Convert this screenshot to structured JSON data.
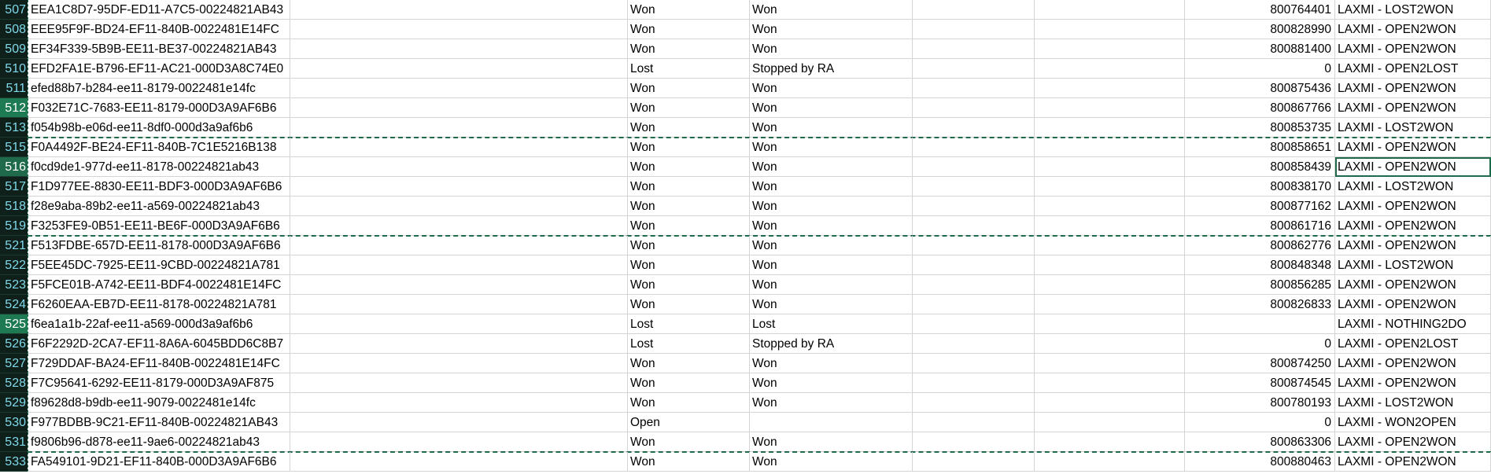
{
  "colors": {
    "accent": "#1e6a4a",
    "rownum_bg": "#0f1f1a",
    "rownum_text": "#7fd9ea",
    "grid": "#d4d4d4"
  },
  "rows": [
    {
      "n": "507",
      "id": "EEA1C8D7-95DF-ED11-A7C5-00224821AB43",
      "status": "Won",
      "outcome": "Won",
      "num": "800764401",
      "label": "LAXMI - LOST2WON"
    },
    {
      "n": "508",
      "id": "EEE95F9F-BD24-EF11-840B-0022481E14FC",
      "status": "Won",
      "outcome": "Won",
      "num": "800828990",
      "label": "LAXMI - OPEN2WON"
    },
    {
      "n": "509",
      "id": "EF34F339-5B9B-EE11-BE37-00224821AB43",
      "status": "Won",
      "outcome": "Won",
      "num": "800881400",
      "label": "LAXMI - OPEN2WON"
    },
    {
      "n": "510",
      "id": "EFD2FA1E-B796-EF11-AC21-000D3A8C74E0",
      "status": "Lost",
      "outcome": "Stopped by RA",
      "num": "0",
      "label": "LAXMI - OPEN2LOST"
    },
    {
      "n": "511",
      "id": "efed88b7-b284-ee11-8179-0022481e14fc",
      "status": "Won",
      "outcome": "Won",
      "num": "800875436",
      "label": "LAXMI - OPEN2WON"
    },
    {
      "n": "512",
      "id": "F032E71C-7683-EE11-8179-000D3A9AF6B6",
      "status": "Won",
      "outcome": "Won",
      "num": "800867766",
      "label": "LAXMI - OPEN2WON"
    },
    {
      "n": "513",
      "id": "f054b98b-e06d-ee11-8df0-000d3a9af6b6",
      "status": "Won",
      "outcome": "Won",
      "num": "800853735",
      "label": "LAXMI - LOST2WON"
    },
    {
      "n": "515",
      "id": "F0A4492F-BE24-EF11-840B-7C1E5216B138",
      "status": "Won",
      "outcome": "Won",
      "num": "800858651",
      "label": "LAXMI - OPEN2WON"
    },
    {
      "n": "516",
      "id": "f0cd9de1-977d-ee11-8178-00224821ab43",
      "status": "Won",
      "outcome": "Won",
      "num": "800858439",
      "label": "LAXMI - OPEN2WON"
    },
    {
      "n": "517",
      "id": "F1D977EE-8830-EE11-BDF3-000D3A9AF6B6",
      "status": "Won",
      "outcome": "Won",
      "num": "800838170",
      "label": "LAXMI - LOST2WON"
    },
    {
      "n": "518",
      "id": "f28e9aba-89b2-ee11-a569-00224821ab43",
      "status": "Won",
      "outcome": "Won",
      "num": "800877162",
      "label": "LAXMI - OPEN2WON"
    },
    {
      "n": "519",
      "id": "F3253FE9-0B51-EE11-BE6F-000D3A9AF6B6",
      "status": "Won",
      "outcome": "Won",
      "num": "800861716",
      "label": "LAXMI - OPEN2WON"
    },
    {
      "n": "521",
      "id": "F513FDBE-657D-EE11-8178-000D3A9AF6B6",
      "status": "Won",
      "outcome": "Won",
      "num": "800862776",
      "label": "LAXMI - OPEN2WON"
    },
    {
      "n": "522",
      "id": "F5EE45DC-7925-EE11-9CBD-00224821A781",
      "status": "Won",
      "outcome": "Won",
      "num": "800848348",
      "label": "LAXMI - LOST2WON"
    },
    {
      "n": "523",
      "id": "F5FCE01B-A742-EE11-BDF4-0022481E14FC",
      "status": "Won",
      "outcome": "Won",
      "num": "800856285",
      "label": "LAXMI - OPEN2WON"
    },
    {
      "n": "524",
      "id": "F6260EAA-EB7D-EE11-8178-00224821A781",
      "status": "Won",
      "outcome": "Won",
      "num": "800826833",
      "label": "LAXMI - OPEN2WON"
    },
    {
      "n": "525",
      "id": "f6ea1a1b-22af-ee11-a569-000d3a9af6b6",
      "status": "Lost",
      "outcome": "Lost",
      "num": "",
      "label": "LAXMI - NOTHING2DO"
    },
    {
      "n": "526",
      "id": "F6F2292D-2CA7-EF11-8A6A-6045BDD6C8B7",
      "status": "Lost",
      "outcome": "Stopped by RA",
      "num": "0",
      "label": "LAXMI - OPEN2LOST"
    },
    {
      "n": "527",
      "id": "F729DDAF-BA24-EF11-840B-0022481E14FC",
      "status": "Won",
      "outcome": "Won",
      "num": "800874250",
      "label": "LAXMI - OPEN2WON"
    },
    {
      "n": "528",
      "id": "F7C95641-6292-EE11-8179-000D3A9AF875",
      "status": "Won",
      "outcome": "Won",
      "num": "800874545",
      "label": "LAXMI - OPEN2WON"
    },
    {
      "n": "529",
      "id": "f89628d8-b9db-ee11-9079-0022481e14fc",
      "status": "Won",
      "outcome": "Won",
      "num": "800780193",
      "label": "LAXMI - LOST2WON"
    },
    {
      "n": "530",
      "id": "F977BDBB-9C21-EF11-840B-00224821AB43",
      "status": "Open",
      "outcome": "",
      "num": "0",
      "label": "LAXMI - WON2OPEN"
    },
    {
      "n": "531",
      "id": "f9806b96-d878-ee11-9ae6-00224821ab43",
      "status": "Won",
      "outcome": "Won",
      "num": "800863306",
      "label": "LAXMI - OPEN2WON"
    },
    {
      "n": "533",
      "id": "FA549101-9D21-EF11-840B-000D3A9AF6B6",
      "status": "Won",
      "outcome": "Won",
      "num": "800880463",
      "label": "LAXMI - OPEN2WON"
    }
  ]
}
